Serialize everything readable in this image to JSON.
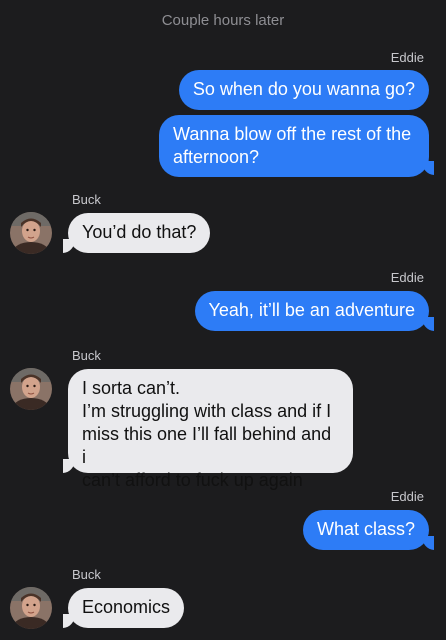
{
  "thread": {
    "timestamp": "Couple hours later",
    "contact_name": "Buck",
    "self_name": "Eddie",
    "colors": {
      "background": "#1c1c1e",
      "outgoing_bubble": "#2d7cf6",
      "incoming_bubble": "#eaeaed"
    }
  },
  "messages": [
    {
      "sender": "Eddie",
      "text": "So when do you wanna go?"
    },
    {
      "sender": "Eddie",
      "text": "Wanna blow off the rest of the\nafternoon?"
    },
    {
      "sender": "Buck",
      "text": "You’d do that?"
    },
    {
      "sender": "Eddie",
      "text": "Yeah, it’ll be an adventure"
    },
    {
      "sender": "Buck",
      "text": "I sorta can’t.\nI’m struggling with class and if I\nmiss this one I’ll fall behind and i\ncan’t afford to fuck up again"
    },
    {
      "sender": "Eddie",
      "text": "What class?"
    },
    {
      "sender": "Buck",
      "text": "Economics"
    }
  ]
}
